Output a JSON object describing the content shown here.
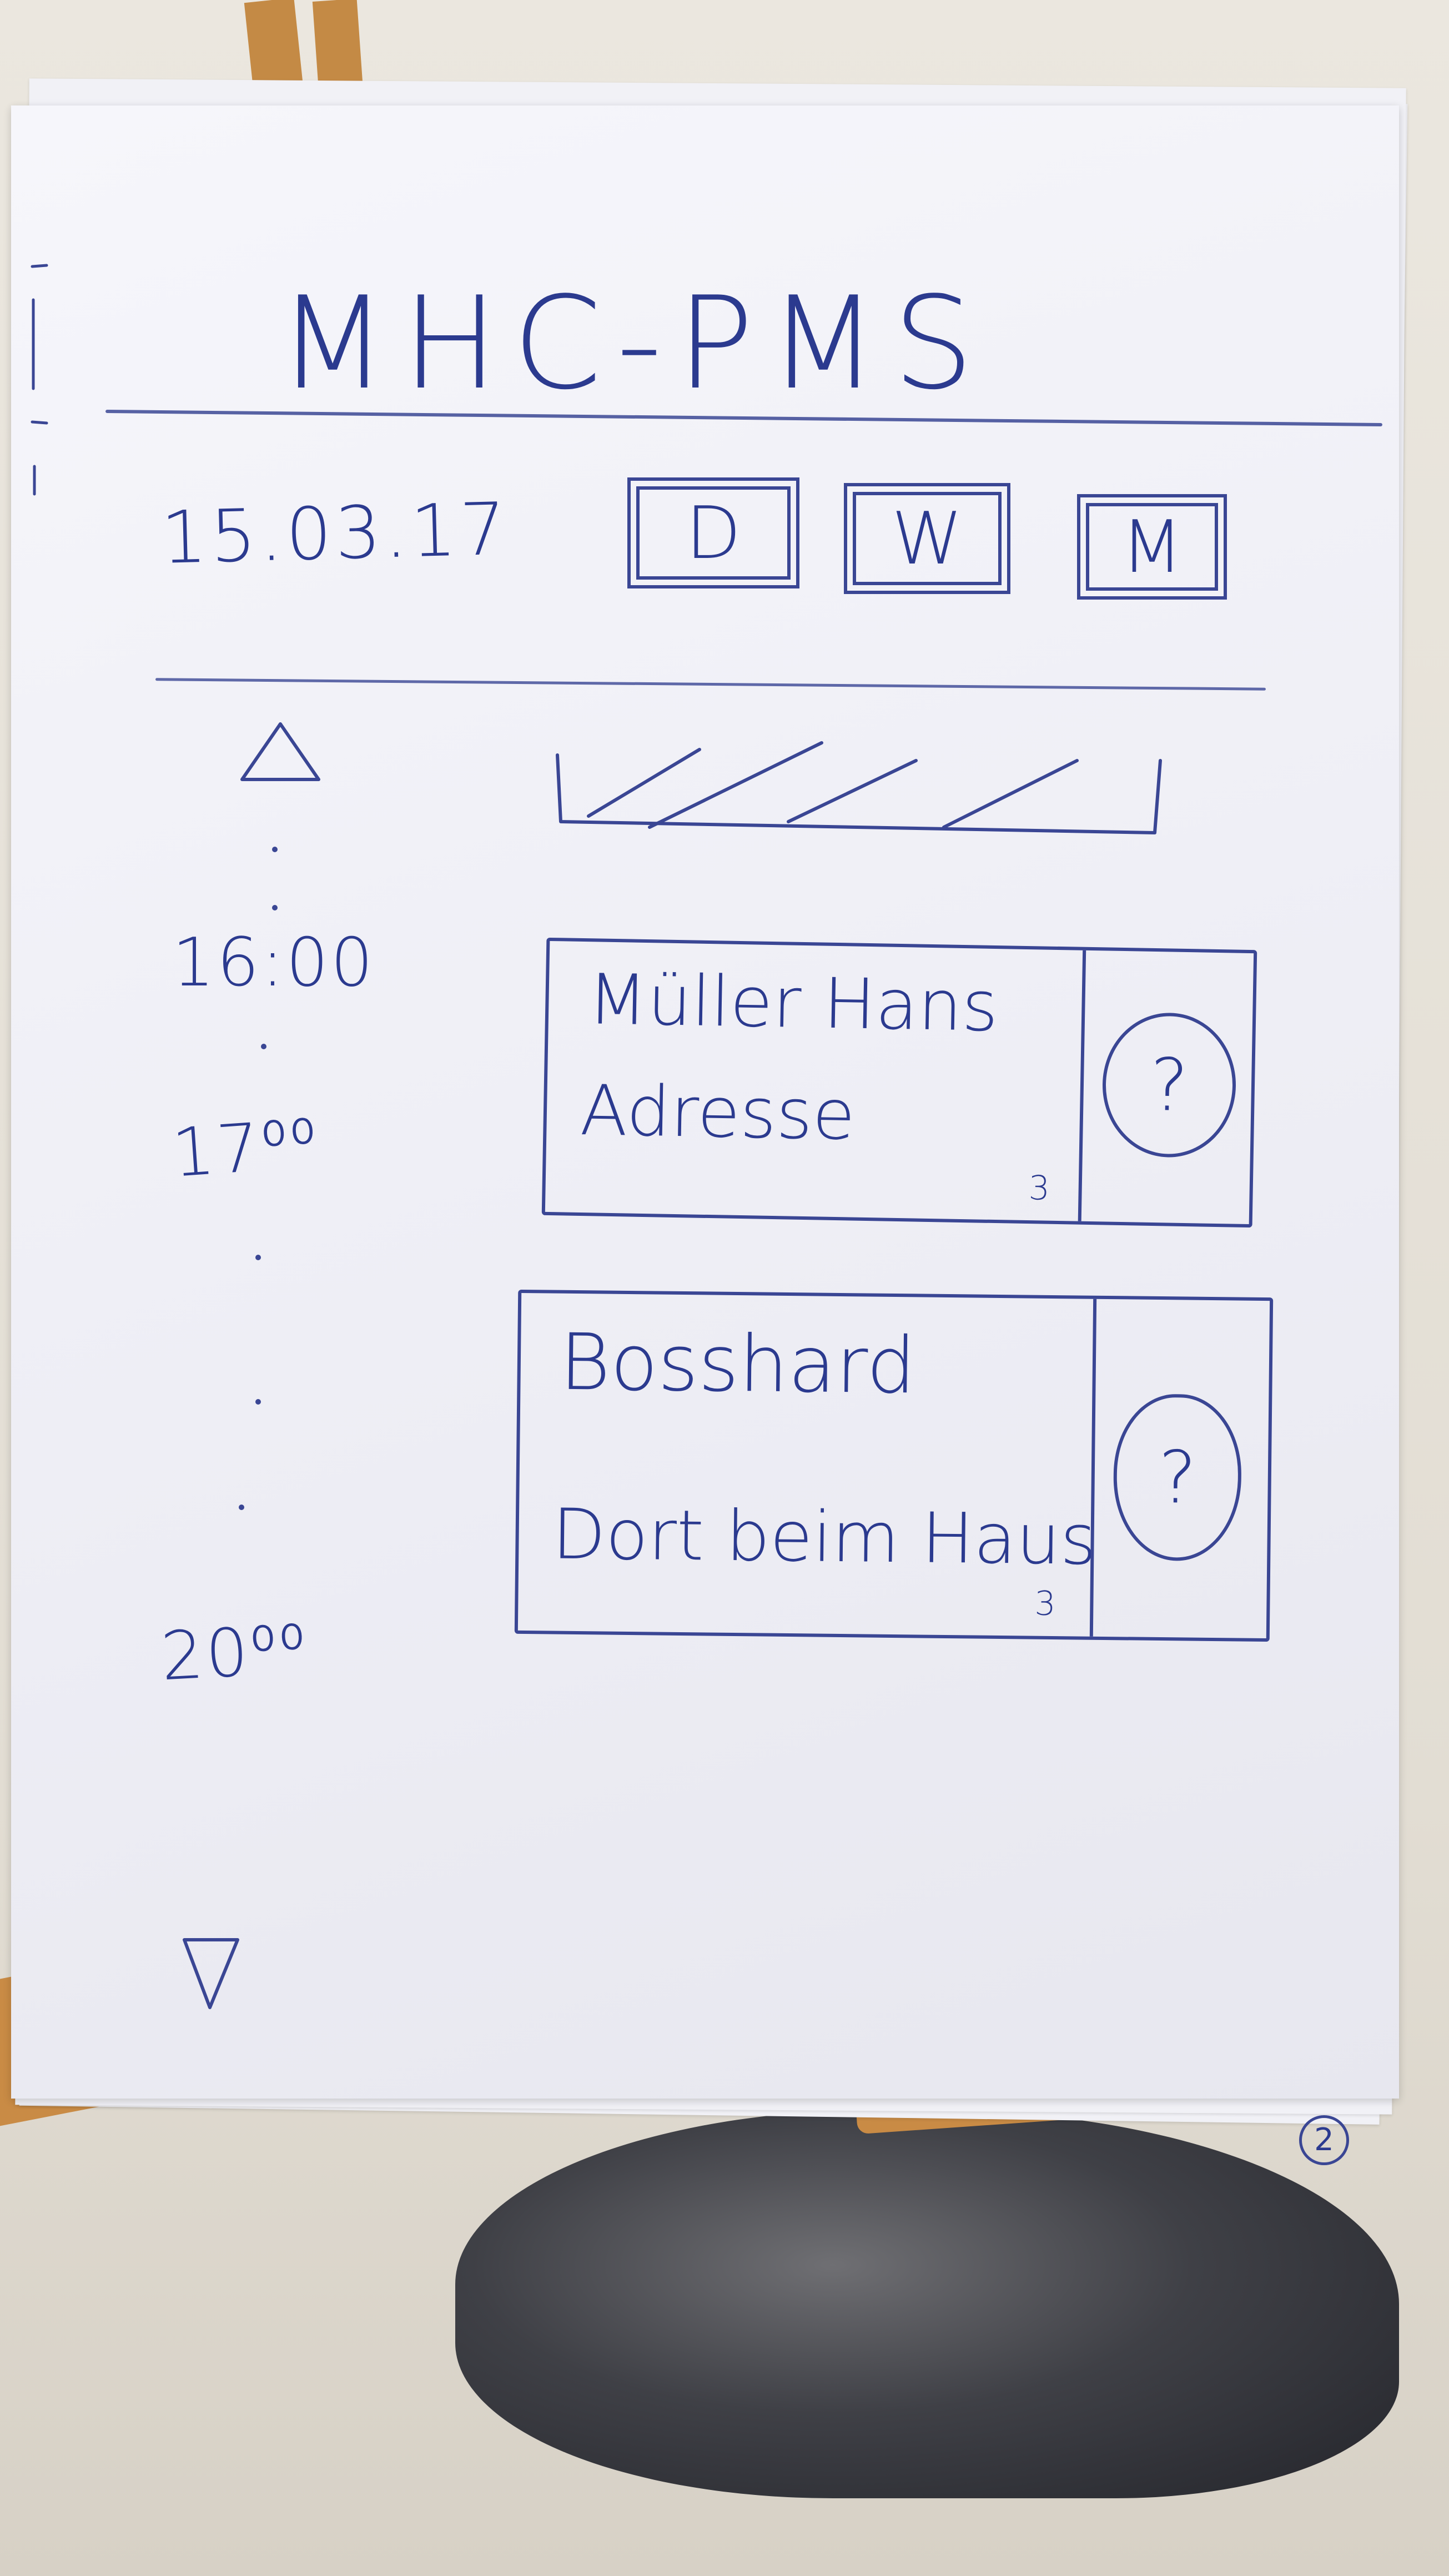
{
  "app": {
    "title": "MHC-PMS"
  },
  "toolbar": {
    "date": "15.03.17",
    "view_buttons": [
      {
        "label": "D"
      },
      {
        "label": "W"
      },
      {
        "label": "M"
      }
    ]
  },
  "timeline": {
    "time_labels": [
      "16:00",
      "17⁰⁰",
      "20⁰⁰"
    ]
  },
  "appointments": [
    {
      "name": "Müller Hans",
      "address": "Adresse",
      "count": "3",
      "status_symbol": "?"
    },
    {
      "name": "Bosshard",
      "address": "Dort beim Haus",
      "count": "3",
      "status_symbol": "?"
    }
  ],
  "page": {
    "number": "2"
  },
  "icons": {
    "scroll_up": "triangle-up-icon",
    "scroll_down": "triangle-down-icon"
  },
  "colors": {
    "ink": "#2b3a8f",
    "paper": "#f1f1f6"
  }
}
